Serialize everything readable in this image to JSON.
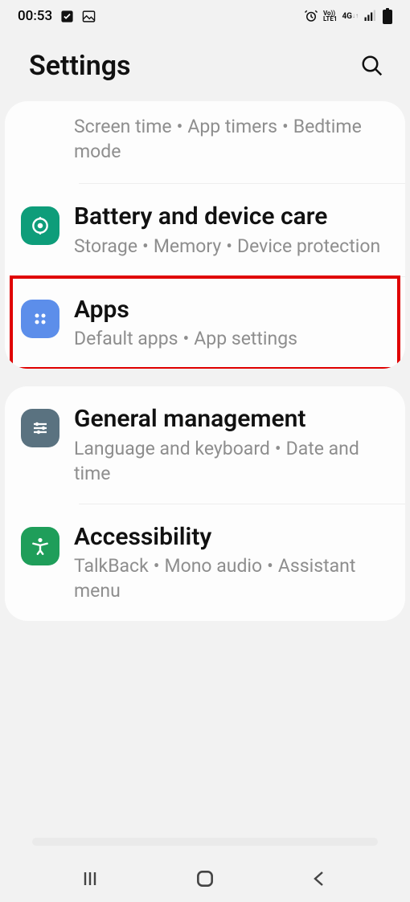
{
  "status": {
    "time": "00:53"
  },
  "header": {
    "title": "Settings"
  },
  "card1": {
    "row0": {
      "sub_a": "Screen time",
      "sub_b": "App timers",
      "sub_c": "Bedtime mode"
    },
    "row1": {
      "title": "Battery and device care",
      "sub_a": "Storage",
      "sub_b": "Memory",
      "sub_c": "Device protection"
    },
    "row2": {
      "title": "Apps",
      "sub_a": "Default apps",
      "sub_b": "App settings"
    }
  },
  "card2": {
    "row0": {
      "title": "General management",
      "sub_a": "Language and keyboard",
      "sub_b": "Date and time"
    },
    "row1": {
      "title": "Accessibility",
      "sub_a": "TalkBack",
      "sub_b": "Mono audio",
      "sub_c": "Assistant menu"
    }
  },
  "colors": {
    "highlight": "#e00000"
  }
}
